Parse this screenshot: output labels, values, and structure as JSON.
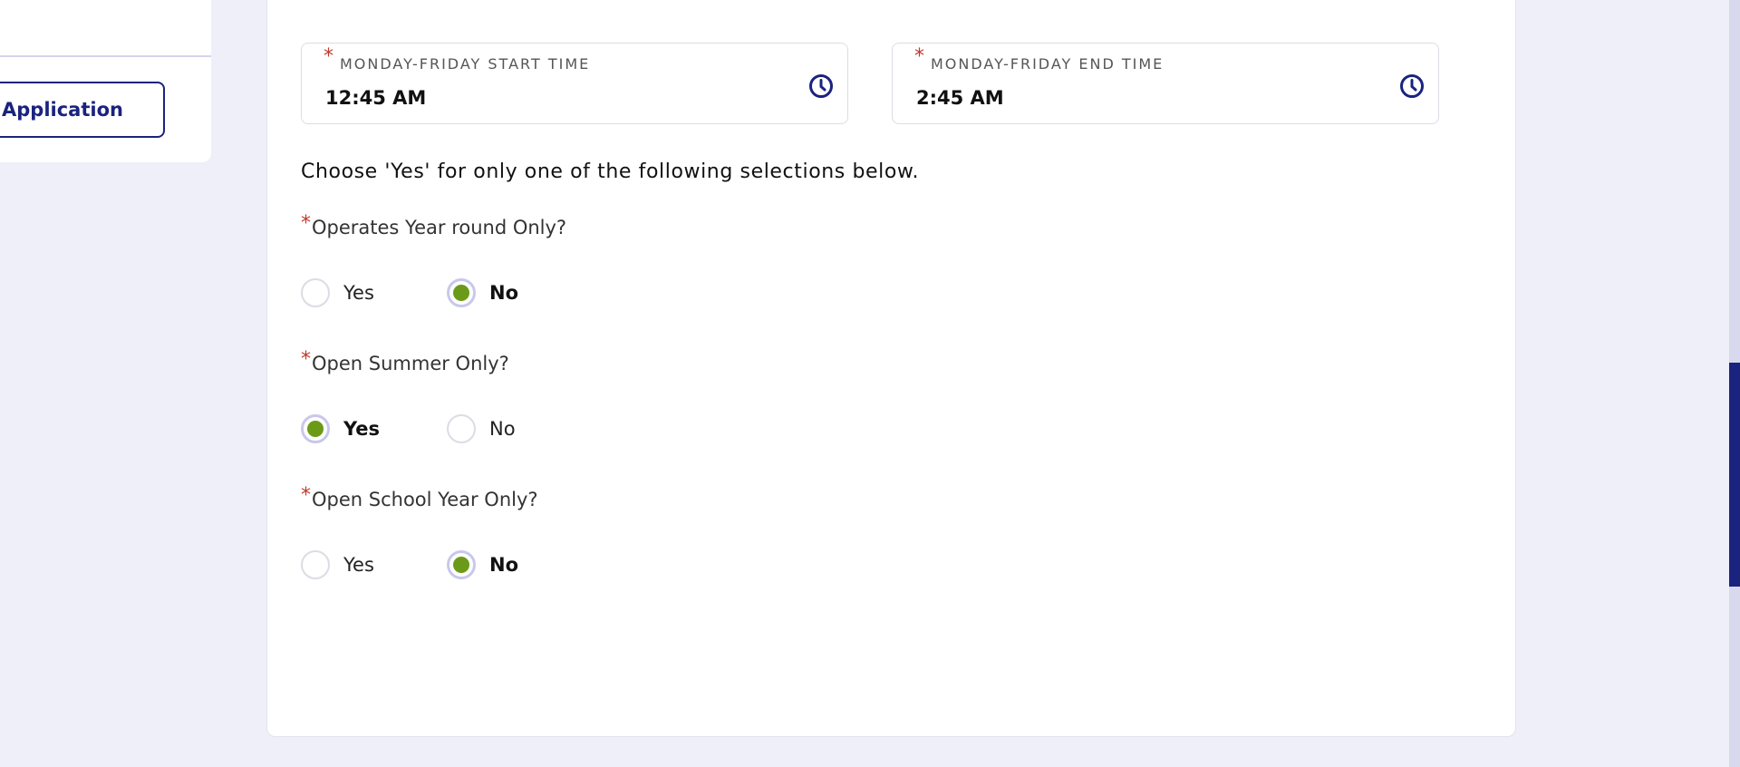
{
  "sidebar": {
    "button_label": "Application"
  },
  "time_fields": {
    "start": {
      "label": "MONDAY-FRIDAY START TIME",
      "value": "12:45 AM",
      "icon": "clock-icon"
    },
    "end": {
      "label": "MONDAY-FRIDAY END TIME",
      "value": "2:45 AM",
      "icon": "clock-icon"
    }
  },
  "required_marker": "*",
  "instructions": "Choose 'Yes' for only one of the following selections below.",
  "questions": [
    {
      "label": "Operates Year round Only?",
      "options": [
        "Yes",
        "No"
      ],
      "selected": "No"
    },
    {
      "label": "Open Summer Only?",
      "options": [
        "Yes",
        "No"
      ],
      "selected": "Yes"
    },
    {
      "label": "Open School Year Only?",
      "options": [
        "Yes",
        "No"
      ],
      "selected": "No"
    }
  ],
  "colors": {
    "brand": "#1a237e",
    "radio_checked": "#6b9a18",
    "required": "#c0392b",
    "background": "#efeff9"
  }
}
